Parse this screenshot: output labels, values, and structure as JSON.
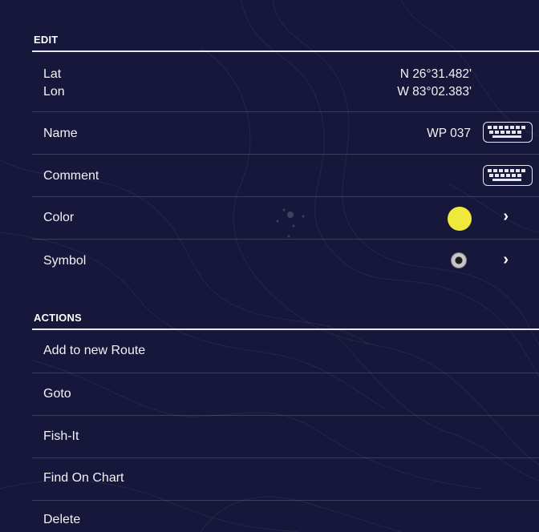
{
  "edit": {
    "header": "EDIT",
    "lat_label": "Lat",
    "lon_label": "Lon",
    "lat_value": "N 26°31.482'",
    "lon_value": "W 83°02.383'",
    "name_label": "Name",
    "name_value": "WP 037",
    "comment_label": "Comment",
    "color_label": "Color",
    "color_value": "#f0e83a",
    "symbol_label": "Symbol",
    "symbol_icon": "circle-marker-icon",
    "keyboard_icon": "keyboard-icon",
    "chevron_glyph": "›"
  },
  "actions": {
    "header": "ACTIONS",
    "items": [
      {
        "label": "Add to new Route"
      },
      {
        "label": "Goto"
      },
      {
        "label": "Fish-It"
      },
      {
        "label": "Find On Chart"
      },
      {
        "label": "Delete"
      }
    ]
  },
  "colors": {
    "background": "#16173a",
    "text": "#ffffff",
    "divider": "#e8e8f0"
  }
}
